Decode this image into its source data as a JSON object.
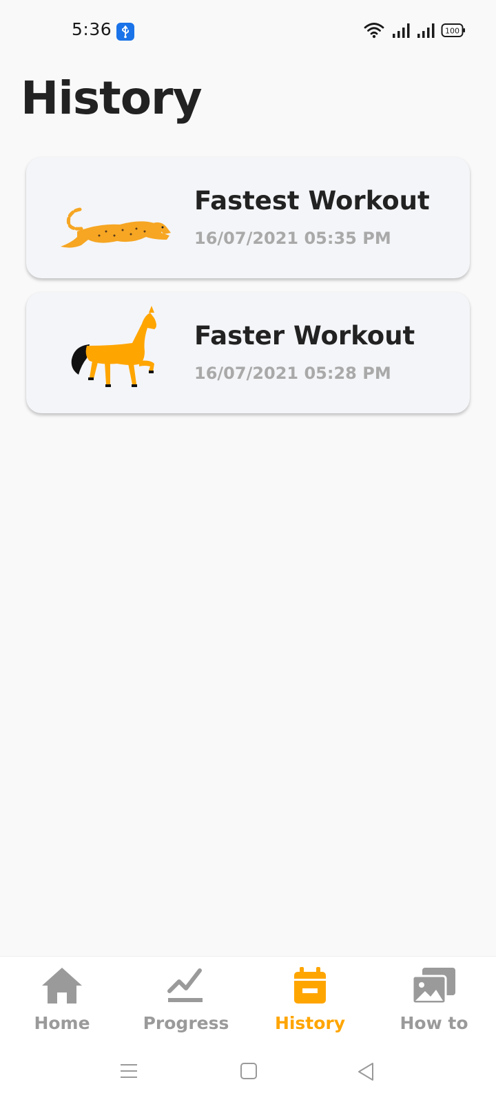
{
  "status_bar": {
    "time": "5:36",
    "battery": "100",
    "icons": [
      "usb-icon",
      "wifi-icon",
      "signal-icon",
      "signal-icon",
      "battery-icon"
    ]
  },
  "page": {
    "title": "History"
  },
  "workouts": [
    {
      "title": "Fastest Workout",
      "date": "16/07/2021 05:35 PM",
      "illustration": "cheetah"
    },
    {
      "title": "Faster Workout",
      "date": "16/07/2021 05:28 PM",
      "illustration": "horse"
    }
  ],
  "bottom_nav": {
    "items": [
      {
        "label": "Home",
        "icon": "home-icon",
        "active": false
      },
      {
        "label": "Progress",
        "icon": "chart-icon",
        "active": false
      },
      {
        "label": "History",
        "icon": "calendar-icon",
        "active": true
      },
      {
        "label": "How to",
        "icon": "gallery-icon",
        "active": false
      }
    ]
  },
  "system_nav": {
    "buttons": [
      "menu",
      "home",
      "back"
    ]
  },
  "colors": {
    "accent": "#ffa500",
    "inactive": "#9a9a9a",
    "card_bg": "#f4f5f8",
    "page_bg": "#f9f9f9"
  }
}
